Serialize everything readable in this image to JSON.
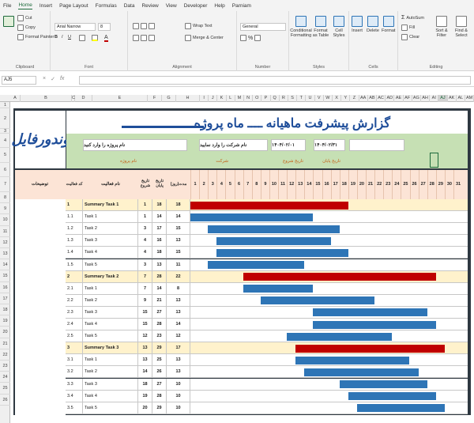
{
  "menu": {
    "tabs": [
      "File",
      "Home",
      "Insert",
      "Page Layout",
      "Formulas",
      "Data",
      "Review",
      "View",
      "Developer",
      "Help",
      "Parniam"
    ],
    "active": "Home"
  },
  "ribbon": {
    "clipboard": {
      "label": "Clipboard",
      "cut": "Cut",
      "copy": "Copy",
      "format_painter": "Format Painter",
      "paste": "Paste"
    },
    "font": {
      "label": "Font",
      "name": "Arial Narrow",
      "size": "8"
    },
    "alignment": {
      "label": "Alignment",
      "wrap_text": "Wrap Text",
      "merge_center": "Merge & Center"
    },
    "number": {
      "label": "Number",
      "format": "General"
    },
    "styles": {
      "label": "Styles",
      "conditional": "Conditional Formatting",
      "format_table": "Format as Table",
      "cell_styles": "Cell Styles"
    },
    "cells": {
      "label": "Cells",
      "insert": "Insert",
      "delete": "Delete",
      "format": "Format"
    },
    "editing": {
      "label": "Editing",
      "autosum": "AutoSum",
      "fill": "Fill",
      "clear": "Clear",
      "sort_filter": "Sort & Filter",
      "find_select": "Find & Select"
    }
  },
  "formula_bar": {
    "name_box": "AJ5",
    "content": ""
  },
  "columns": [
    "A",
    "B",
    "C",
    "D",
    "E",
    "F",
    "G",
    "H",
    "I",
    "J",
    "K",
    "L",
    "M",
    "N",
    "O",
    "P",
    "Q",
    "R",
    "S",
    "T",
    "U",
    "V",
    "W",
    "X",
    "Y",
    "Z",
    "AA",
    "AB",
    "AC",
    "AD",
    "AE",
    "AF",
    "AG",
    "AH",
    "AI",
    "AJ",
    "AK",
    "AL",
    "AM",
    "AN"
  ],
  "selected_column": "AJ",
  "rows": [
    "1",
    "2",
    "3",
    "4",
    "5",
    "6",
    "7",
    "8",
    "9",
    "10",
    "11",
    "12",
    "13",
    "14",
    "15",
    "16",
    "17",
    "18",
    "19",
    "20",
    "21",
    "22",
    "23",
    "24",
    "25",
    "26"
  ],
  "sheet": {
    "logo_text": "وندورفایل",
    "title": "گزارش پیشرفت ماهیانه ــــ ماه پروژه",
    "project_name": "نام پروژه را وارد کنید",
    "company_name": "نام شرکت را وارد نمایید",
    "start_date": "۱۴۰۴/۰۲/۰۱",
    "end_date": "۱۴۰۴/۰۲/۳۱",
    "label_project": "نام پروژه",
    "label_company": "شرکت",
    "label_start": "تاریخ شروع",
    "label_end": "تاریخ پایان",
    "header_desc": "توضیحات",
    "header_code": "کد فعالیت",
    "header_name": "نام فعالیت",
    "header_start": "تاریخ شروع",
    "header_end": "تاریخ پایان",
    "header_duration": "مدت(روز)",
    "days": [
      "1",
      "2",
      "3",
      "4",
      "5",
      "6",
      "7",
      "8",
      "9",
      "10",
      "11",
      "12",
      "13",
      "14",
      "15",
      "16",
      "17",
      "18",
      "19",
      "20",
      "21",
      "22",
      "23",
      "24",
      "25",
      "26",
      "27",
      "28",
      "29",
      "30",
      "31"
    ]
  },
  "tasks": [
    {
      "code": "1",
      "name": "Summary Task 1",
      "start": "1",
      "end": "18",
      "dur": "18",
      "summary": true
    },
    {
      "code": "1.1",
      "name": "Task 1",
      "start": "1",
      "end": "14",
      "dur": "14",
      "summary": false
    },
    {
      "code": "1.2",
      "name": "Task 2",
      "start": "3",
      "end": "17",
      "dur": "15",
      "summary": false
    },
    {
      "code": "1.3",
      "name": "Task 3",
      "start": "4",
      "end": "16",
      "dur": "13",
      "summary": false
    },
    {
      "code": "1.4",
      "name": "Task 4",
      "start": "4",
      "end": "18",
      "dur": "15",
      "summary": false
    },
    {
      "code": "1.5",
      "name": "Task 5",
      "start": "3",
      "end": "13",
      "dur": "11",
      "summary": false
    },
    {
      "code": "2",
      "name": "Summary Task 2",
      "start": "7",
      "end": "28",
      "dur": "22",
      "summary": true
    },
    {
      "code": "2.1",
      "name": "Task 1",
      "start": "7",
      "end": "14",
      "dur": "8",
      "summary": false
    },
    {
      "code": "2.2",
      "name": "Task 2",
      "start": "9",
      "end": "21",
      "dur": "13",
      "summary": false
    },
    {
      "code": "2.3",
      "name": "Task 3",
      "start": "15",
      "end": "27",
      "dur": "13",
      "summary": false
    },
    {
      "code": "2.4",
      "name": "Task 4",
      "start": "15",
      "end": "28",
      "dur": "14",
      "summary": false
    },
    {
      "code": "2.5",
      "name": "Task 5",
      "start": "12",
      "end": "23",
      "dur": "12",
      "summary": false
    },
    {
      "code": "3",
      "name": "Summary Task 3",
      "start": "13",
      "end": "29",
      "dur": "17",
      "summary": true
    },
    {
      "code": "3.1",
      "name": "Task 1",
      "start": "13",
      "end": "25",
      "dur": "13",
      "summary": false
    },
    {
      "code": "3.2",
      "name": "Task 2",
      "start": "14",
      "end": "26",
      "dur": "13",
      "summary": false
    },
    {
      "code": "3.3",
      "name": "Task 3",
      "start": "18",
      "end": "27",
      "dur": "10",
      "summary": false
    },
    {
      "code": "3.4",
      "name": "Task 4",
      "start": "19",
      "end": "28",
      "dur": "10",
      "summary": false
    },
    {
      "code": "3.5",
      "name": "Task 5",
      "start": "20",
      "end": "29",
      "dur": "10",
      "summary": false
    }
  ],
  "colors": {
    "summary_bar": "#c00000",
    "task_bar": "#2e75b6",
    "header_green": "#c6e0b4",
    "header_peach": "#fce4d6",
    "summary_row": "#fff2cc",
    "accent": "#1e6b3c"
  }
}
